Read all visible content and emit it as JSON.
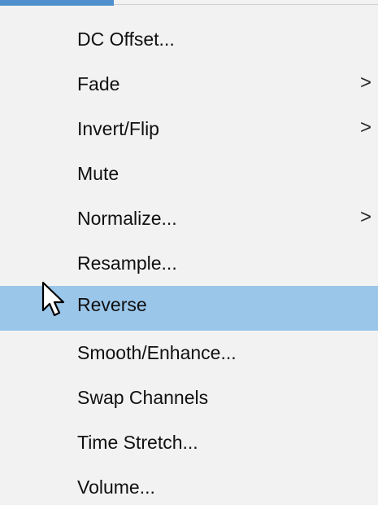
{
  "menu": {
    "items": [
      {
        "label": "DC Offset...",
        "submenu": false,
        "highlighted": false
      },
      {
        "label": "Fade",
        "submenu": true,
        "highlighted": false
      },
      {
        "label": "Invert/Flip",
        "submenu": true,
        "highlighted": false
      },
      {
        "label": "Mute",
        "submenu": false,
        "highlighted": false
      },
      {
        "label": "Normalize...",
        "submenu": true,
        "highlighted": false
      },
      {
        "label": "Resample...",
        "submenu": false,
        "highlighted": false
      },
      {
        "label": "Reverse",
        "submenu": false,
        "highlighted": true
      },
      {
        "label": "Smooth/Enhance...",
        "submenu": false,
        "highlighted": false
      },
      {
        "label": "Swap Channels",
        "submenu": false,
        "highlighted": false
      },
      {
        "label": "Time Stretch...",
        "submenu": false,
        "highlighted": false
      },
      {
        "label": "Volume...",
        "submenu": false,
        "highlighted": false
      }
    ],
    "submenu_glyph": ">"
  },
  "colors": {
    "menu_background": "#f2f2f2",
    "highlight": "#9ac6ea",
    "accent": "#4f90cf",
    "text": "#101010"
  },
  "icons": {
    "cursor": "mouse-pointer-icon"
  }
}
